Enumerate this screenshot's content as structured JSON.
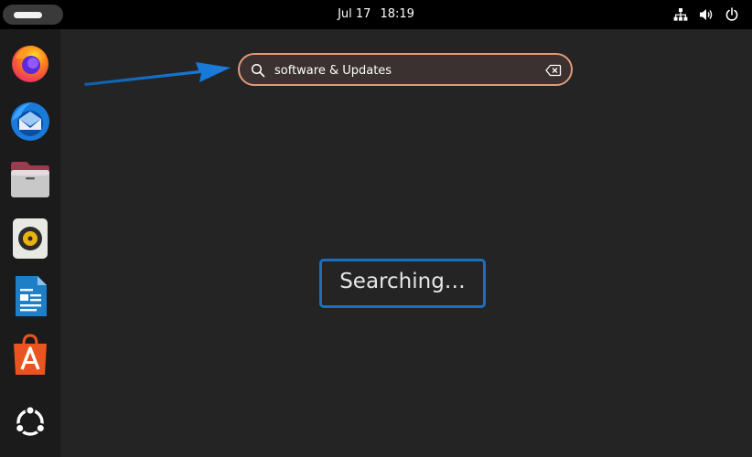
{
  "topbar": {
    "date": "Jul 17",
    "time": "18:19",
    "tray_icons": [
      "network-icon",
      "volume-icon",
      "power-icon"
    ]
  },
  "dock": {
    "apps": [
      {
        "name": "Firefox",
        "icon": "firefox-icon"
      },
      {
        "name": "Thunderbird",
        "icon": "thunderbird-icon"
      },
      {
        "name": "Files",
        "icon": "files-icon"
      },
      {
        "name": "Rhythmbox",
        "icon": "rhythmbox-icon"
      },
      {
        "name": "LibreOffice Writer",
        "icon": "writer-icon"
      },
      {
        "name": "App Center",
        "icon": "app-center-icon"
      },
      {
        "name": "Show Apps",
        "icon": "show-apps-icon"
      }
    ]
  },
  "search": {
    "value": "software & Updates",
    "icon": "search-icon",
    "clear_icon": "clear-icon"
  },
  "status": {
    "text": "Searching…"
  },
  "annotation": {
    "arrow_color": "#1a6fc2",
    "highlight_color": "#1a6fc2"
  }
}
